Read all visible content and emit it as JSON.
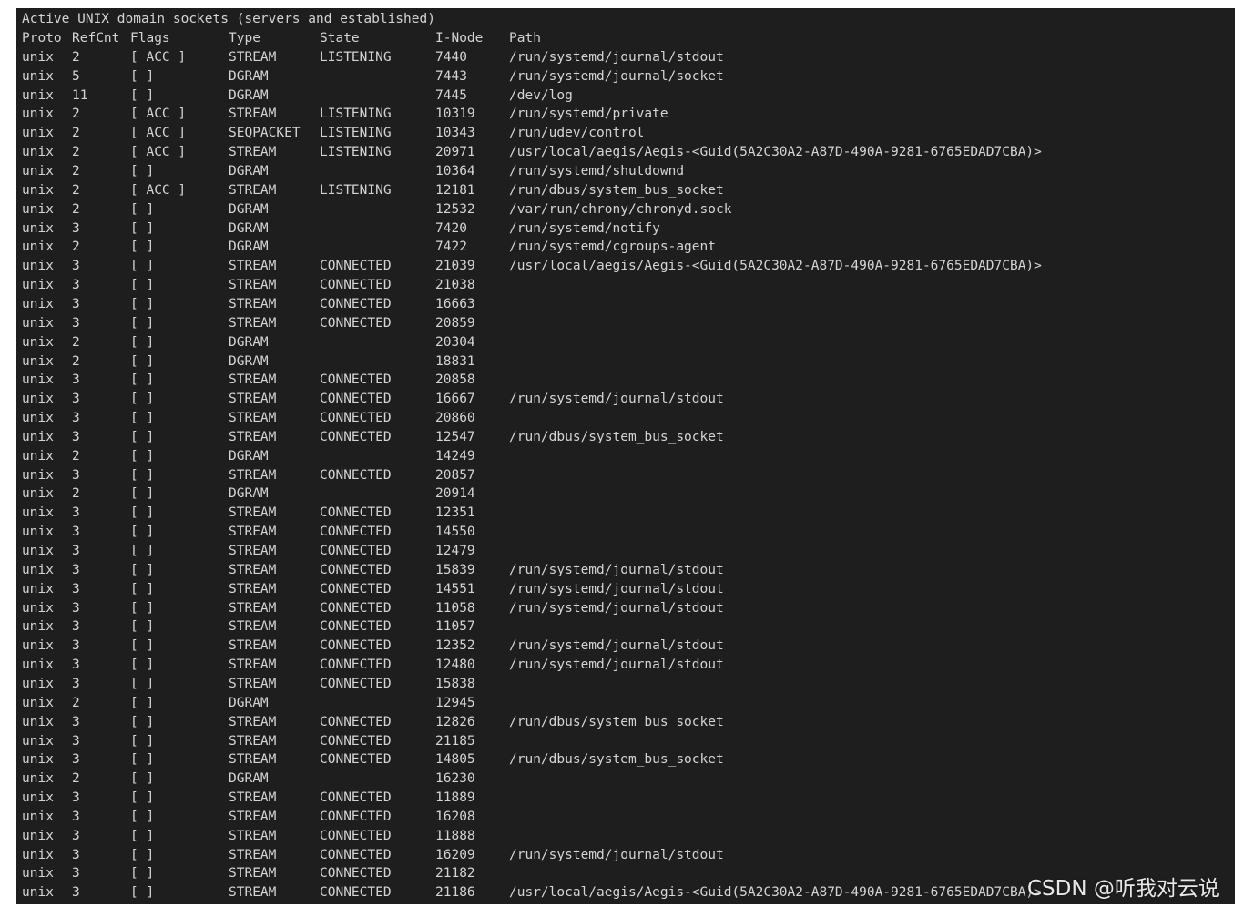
{
  "terminal": {
    "partial_top_line": "",
    "title_line": "Active UNIX domain sockets (servers and established)",
    "headers": {
      "proto": "Proto",
      "refcnt": "RefCnt",
      "flags": "Flags",
      "type": "Type",
      "state": "State",
      "inode": "I-Node",
      "path": "Path"
    },
    "rows": [
      {
        "proto": "unix",
        "refcnt": "2",
        "flags": "[ ACC ]",
        "type": "STREAM",
        "state": "LISTENING",
        "inode": "7440",
        "path": "/run/systemd/journal/stdout"
      },
      {
        "proto": "unix",
        "refcnt": "5",
        "flags": "[ ]",
        "type": "DGRAM",
        "state": "",
        "inode": "7443",
        "path": "/run/systemd/journal/socket"
      },
      {
        "proto": "unix",
        "refcnt": "11",
        "flags": "[ ]",
        "type": "DGRAM",
        "state": "",
        "inode": "7445",
        "path": "/dev/log"
      },
      {
        "proto": "unix",
        "refcnt": "2",
        "flags": "[ ACC ]",
        "type": "STREAM",
        "state": "LISTENING",
        "inode": "10319",
        "path": "/run/systemd/private"
      },
      {
        "proto": "unix",
        "refcnt": "2",
        "flags": "[ ACC ]",
        "type": "SEQPACKET",
        "state": "LISTENING",
        "inode": "10343",
        "path": "/run/udev/control"
      },
      {
        "proto": "unix",
        "refcnt": "2",
        "flags": "[ ACC ]",
        "type": "STREAM",
        "state": "LISTENING",
        "inode": "20971",
        "path": "/usr/local/aegis/Aegis-<Guid(5A2C30A2-A87D-490A-9281-6765EDAD7CBA)>"
      },
      {
        "proto": "unix",
        "refcnt": "2",
        "flags": "[ ]",
        "type": "DGRAM",
        "state": "",
        "inode": "10364",
        "path": "/run/systemd/shutdownd"
      },
      {
        "proto": "unix",
        "refcnt": "2",
        "flags": "[ ACC ]",
        "type": "STREAM",
        "state": "LISTENING",
        "inode": "12181",
        "path": "/run/dbus/system_bus_socket"
      },
      {
        "proto": "unix",
        "refcnt": "2",
        "flags": "[ ]",
        "type": "DGRAM",
        "state": "",
        "inode": "12532",
        "path": "/var/run/chrony/chronyd.sock"
      },
      {
        "proto": "unix",
        "refcnt": "3",
        "flags": "[ ]",
        "type": "DGRAM",
        "state": "",
        "inode": "7420",
        "path": "/run/systemd/notify"
      },
      {
        "proto": "unix",
        "refcnt": "2",
        "flags": "[ ]",
        "type": "DGRAM",
        "state": "",
        "inode": "7422",
        "path": "/run/systemd/cgroups-agent"
      },
      {
        "proto": "unix",
        "refcnt": "3",
        "flags": "[ ]",
        "type": "STREAM",
        "state": "CONNECTED",
        "inode": "21039",
        "path": "/usr/local/aegis/Aegis-<Guid(5A2C30A2-A87D-490A-9281-6765EDAD7CBA)>"
      },
      {
        "proto": "unix",
        "refcnt": "3",
        "flags": "[ ]",
        "type": "STREAM",
        "state": "CONNECTED",
        "inode": "21038",
        "path": ""
      },
      {
        "proto": "unix",
        "refcnt": "3",
        "flags": "[ ]",
        "type": "STREAM",
        "state": "CONNECTED",
        "inode": "16663",
        "path": ""
      },
      {
        "proto": "unix",
        "refcnt": "3",
        "flags": "[ ]",
        "type": "STREAM",
        "state": "CONNECTED",
        "inode": "20859",
        "path": ""
      },
      {
        "proto": "unix",
        "refcnt": "2",
        "flags": "[ ]",
        "type": "DGRAM",
        "state": "",
        "inode": "20304",
        "path": ""
      },
      {
        "proto": "unix",
        "refcnt": "2",
        "flags": "[ ]",
        "type": "DGRAM",
        "state": "",
        "inode": "18831",
        "path": ""
      },
      {
        "proto": "unix",
        "refcnt": "3",
        "flags": "[ ]",
        "type": "STREAM",
        "state": "CONNECTED",
        "inode": "20858",
        "path": ""
      },
      {
        "proto": "unix",
        "refcnt": "3",
        "flags": "[ ]",
        "type": "STREAM",
        "state": "CONNECTED",
        "inode": "16667",
        "path": "/run/systemd/journal/stdout"
      },
      {
        "proto": "unix",
        "refcnt": "3",
        "flags": "[ ]",
        "type": "STREAM",
        "state": "CONNECTED",
        "inode": "20860",
        "path": ""
      },
      {
        "proto": "unix",
        "refcnt": "3",
        "flags": "[ ]",
        "type": "STREAM",
        "state": "CONNECTED",
        "inode": "12547",
        "path": "/run/dbus/system_bus_socket"
      },
      {
        "proto": "unix",
        "refcnt": "2",
        "flags": "[ ]",
        "type": "DGRAM",
        "state": "",
        "inode": "14249",
        "path": ""
      },
      {
        "proto": "unix",
        "refcnt": "3",
        "flags": "[ ]",
        "type": "STREAM",
        "state": "CONNECTED",
        "inode": "20857",
        "path": ""
      },
      {
        "proto": "unix",
        "refcnt": "2",
        "flags": "[ ]",
        "type": "DGRAM",
        "state": "",
        "inode": "20914",
        "path": ""
      },
      {
        "proto": "unix",
        "refcnt": "3",
        "flags": "[ ]",
        "type": "STREAM",
        "state": "CONNECTED",
        "inode": "12351",
        "path": ""
      },
      {
        "proto": "unix",
        "refcnt": "3",
        "flags": "[ ]",
        "type": "STREAM",
        "state": "CONNECTED",
        "inode": "14550",
        "path": ""
      },
      {
        "proto": "unix",
        "refcnt": "3",
        "flags": "[ ]",
        "type": "STREAM",
        "state": "CONNECTED",
        "inode": "12479",
        "path": ""
      },
      {
        "proto": "unix",
        "refcnt": "3",
        "flags": "[ ]",
        "type": "STREAM",
        "state": "CONNECTED",
        "inode": "15839",
        "path": "/run/systemd/journal/stdout"
      },
      {
        "proto": "unix",
        "refcnt": "3",
        "flags": "[ ]",
        "type": "STREAM",
        "state": "CONNECTED",
        "inode": "14551",
        "path": "/run/systemd/journal/stdout"
      },
      {
        "proto": "unix",
        "refcnt": "3",
        "flags": "[ ]",
        "type": "STREAM",
        "state": "CONNECTED",
        "inode": "11058",
        "path": "/run/systemd/journal/stdout"
      },
      {
        "proto": "unix",
        "refcnt": "3",
        "flags": "[ ]",
        "type": "STREAM",
        "state": "CONNECTED",
        "inode": "11057",
        "path": ""
      },
      {
        "proto": "unix",
        "refcnt": "3",
        "flags": "[ ]",
        "type": "STREAM",
        "state": "CONNECTED",
        "inode": "12352",
        "path": "/run/systemd/journal/stdout"
      },
      {
        "proto": "unix",
        "refcnt": "3",
        "flags": "[ ]",
        "type": "STREAM",
        "state": "CONNECTED",
        "inode": "12480",
        "path": "/run/systemd/journal/stdout"
      },
      {
        "proto": "unix",
        "refcnt": "3",
        "flags": "[ ]",
        "type": "STREAM",
        "state": "CONNECTED",
        "inode": "15838",
        "path": ""
      },
      {
        "proto": "unix",
        "refcnt": "2",
        "flags": "[ ]",
        "type": "DGRAM",
        "state": "",
        "inode": "12945",
        "path": ""
      },
      {
        "proto": "unix",
        "refcnt": "3",
        "flags": "[ ]",
        "type": "STREAM",
        "state": "CONNECTED",
        "inode": "12826",
        "path": "/run/dbus/system_bus_socket"
      },
      {
        "proto": "unix",
        "refcnt": "3",
        "flags": "[ ]",
        "type": "STREAM",
        "state": "CONNECTED",
        "inode": "21185",
        "path": ""
      },
      {
        "proto": "unix",
        "refcnt": "3",
        "flags": "[ ]",
        "type": "STREAM",
        "state": "CONNECTED",
        "inode": "14805",
        "path": "/run/dbus/system_bus_socket"
      },
      {
        "proto": "unix",
        "refcnt": "2",
        "flags": "[ ]",
        "type": "DGRAM",
        "state": "",
        "inode": "16230",
        "path": ""
      },
      {
        "proto": "unix",
        "refcnt": "3",
        "flags": "[ ]",
        "type": "STREAM",
        "state": "CONNECTED",
        "inode": "11889",
        "path": ""
      },
      {
        "proto": "unix",
        "refcnt": "3",
        "flags": "[ ]",
        "type": "STREAM",
        "state": "CONNECTED",
        "inode": "16208",
        "path": ""
      },
      {
        "proto": "unix",
        "refcnt": "3",
        "flags": "[ ]",
        "type": "STREAM",
        "state": "CONNECTED",
        "inode": "11888",
        "path": ""
      },
      {
        "proto": "unix",
        "refcnt": "3",
        "flags": "[ ]",
        "type": "STREAM",
        "state": "CONNECTED",
        "inode": "16209",
        "path": "/run/systemd/journal/stdout"
      },
      {
        "proto": "unix",
        "refcnt": "3",
        "flags": "[ ]",
        "type": "STREAM",
        "state": "CONNECTED",
        "inode": "21182",
        "path": ""
      },
      {
        "proto": "unix",
        "refcnt": "3",
        "flags": "[ ]",
        "type": "STREAM",
        "state": "CONNECTED",
        "inode": "21186",
        "path": "/usr/local/aegis/Aegis-<Guid(5A2C30A2-A87D-490A-9281-6765EDAD7CBA)>"
      }
    ]
  },
  "watermark": "CSDN @听我对云说",
  "colors": {
    "terminal_bg": "#1e1e1e",
    "terminal_fg": "#d4d4d4",
    "page_bg": "#ffffff"
  }
}
